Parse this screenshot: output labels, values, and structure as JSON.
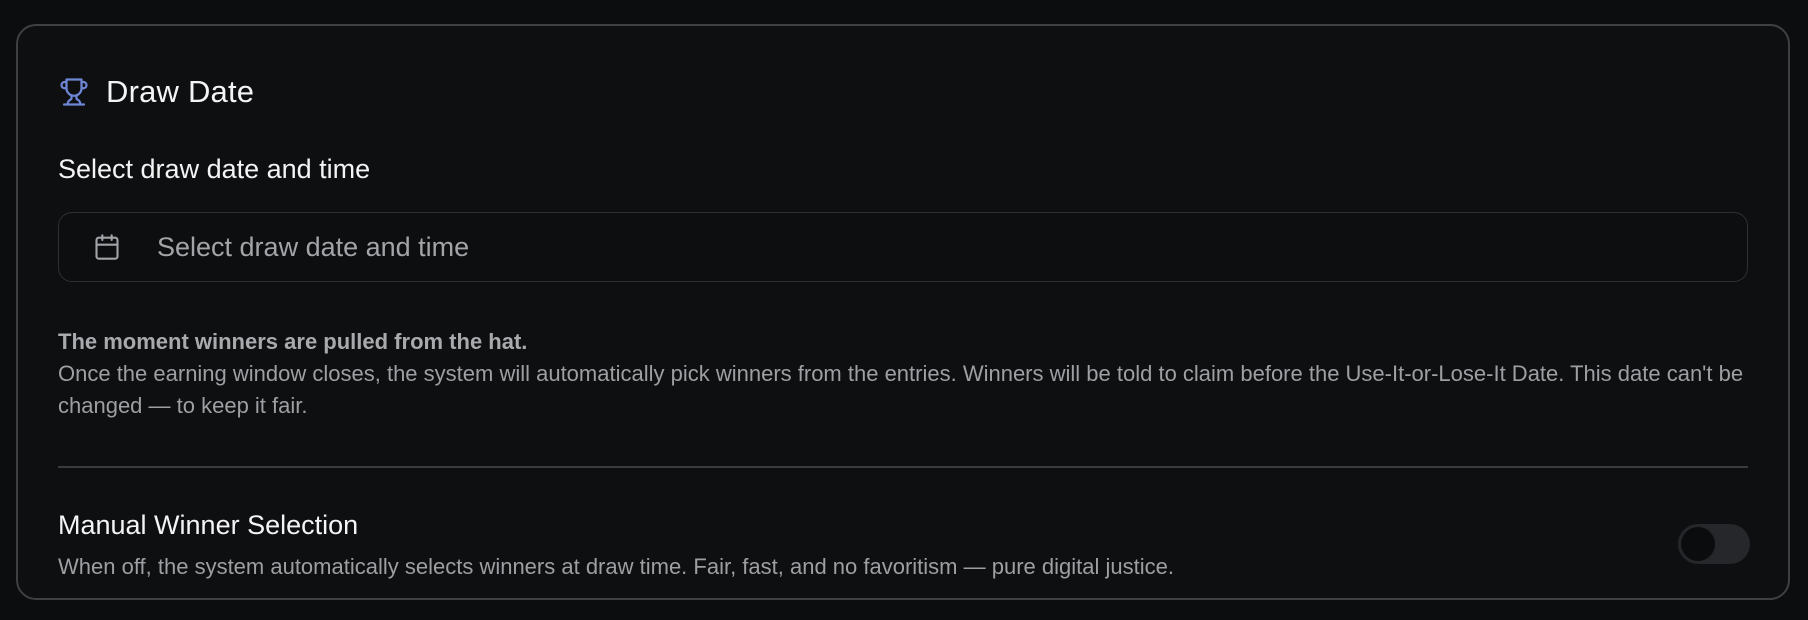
{
  "section": {
    "title": "Draw Date",
    "icon": "trophy-icon",
    "accent_color": "#6f86d6"
  },
  "draw_date": {
    "label": "Select draw date and time",
    "icon": "calendar-icon",
    "value": "",
    "placeholder": "Select draw date and time",
    "help_title": "The moment winners are pulled from the hat.",
    "help_text": "Once the earning window closes, the system will automatically pick winners from the entries. Winners will be told to claim before the Use-It-or-Lose-It Date. This date can't be changed — to keep it fair."
  },
  "manual_selection": {
    "title": "Manual Winner Selection",
    "description": "When off, the system automatically selects winners at draw time. Fair, fast, and no favoritism — pure digital justice.",
    "enabled": false
  }
}
